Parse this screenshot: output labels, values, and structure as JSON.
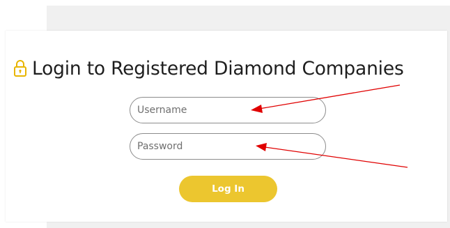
{
  "page": {
    "title": "Login to Registered Diamond Companies"
  },
  "form": {
    "username_placeholder": "Username",
    "username_value": "",
    "password_placeholder": "Password",
    "password_value": "",
    "login_label": "Log In"
  },
  "icons": {
    "title_icon": "lock-icon"
  },
  "colors": {
    "accent": "#ecc62f",
    "lock": "#e8b500",
    "annotation_arrow": "#e00000",
    "title_text": "#1e1e1e"
  }
}
